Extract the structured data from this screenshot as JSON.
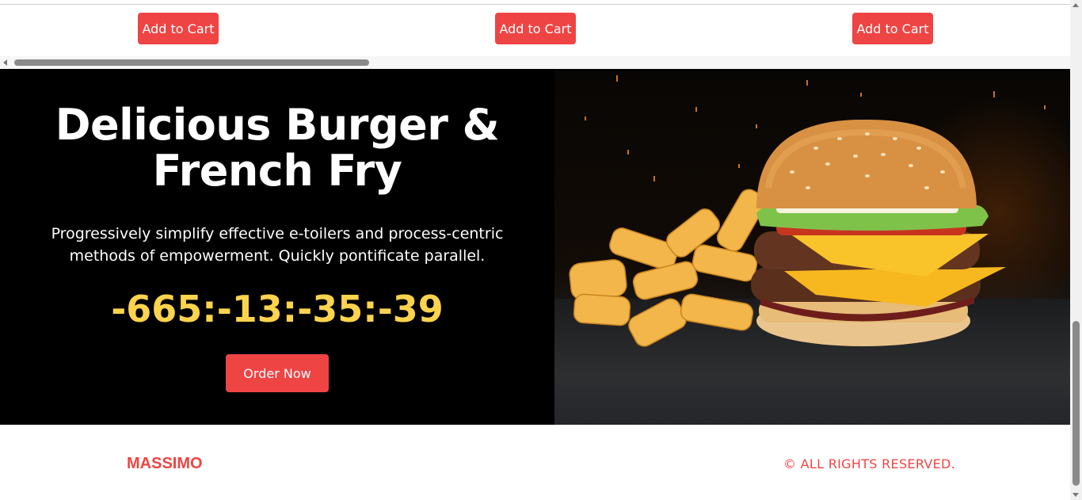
{
  "products": {
    "cart_buttons": [
      "Add to Cart",
      "Add to Cart",
      "Add to Cart"
    ]
  },
  "hero": {
    "title_line1": "Delicious Burger &",
    "title_line2": "French Fry",
    "description": "Progressively simplify effective e-toilers and process-centric methods of empowerment. Quickly pontificate parallel.",
    "countdown": "-665:-13:-35:-39",
    "order_label": "Order Now",
    "image_icon": "burger-fries-image",
    "colors": {
      "timer": "#fcd34d",
      "button": "#ef4444"
    }
  },
  "footer": {
    "brand": "MASSIMO",
    "rights": "© ALL RIGHTS RESERVED."
  },
  "colors": {
    "accent": "#ef4444"
  }
}
